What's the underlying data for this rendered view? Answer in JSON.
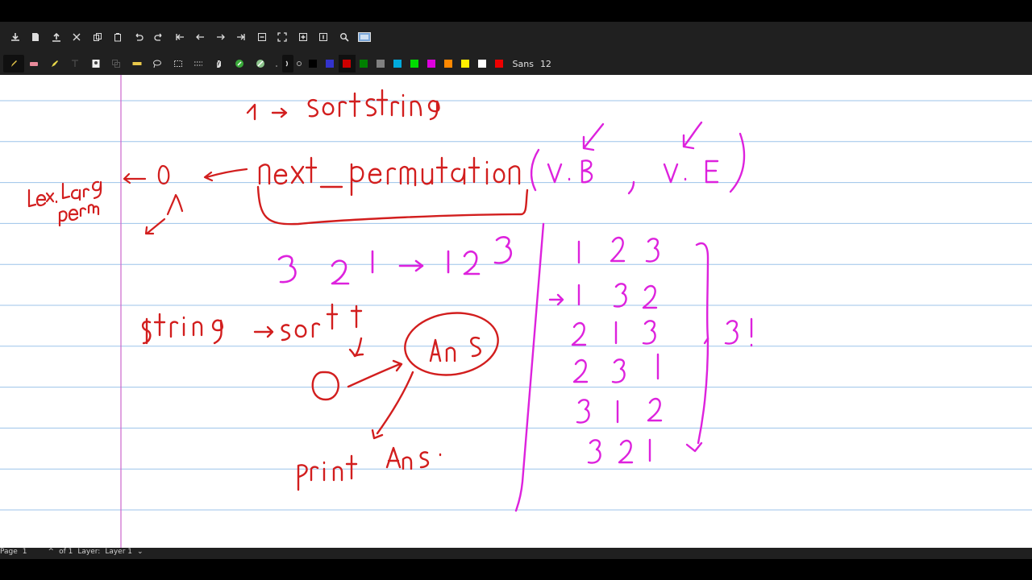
{
  "toolbar_top": {
    "buttons": [
      {
        "name": "save-icon"
      },
      {
        "name": "new-page-icon"
      },
      {
        "name": "upload-icon"
      },
      {
        "name": "cut-icon"
      },
      {
        "name": "copy-icon"
      },
      {
        "name": "paste-icon"
      },
      {
        "name": "undo-icon"
      },
      {
        "name": "redo-icon"
      },
      {
        "name": "first-page-icon"
      },
      {
        "name": "previous-page-icon"
      },
      {
        "name": "next-page-icon"
      },
      {
        "name": "last-page-icon"
      },
      {
        "name": "zoom-out-icon"
      },
      {
        "name": "fit-page-icon"
      },
      {
        "name": "zoom-in-icon"
      },
      {
        "name": "fullscreen-icon"
      },
      {
        "name": "search-icon"
      },
      {
        "name": "image-icon"
      }
    ]
  },
  "toolbar_tools": {
    "font_name": "Sans",
    "font_size": "12",
    "colors": [
      "#000000",
      "#3333cc",
      "#cc0000",
      "#008000",
      "#808080",
      "#00aadd",
      "#00dd00",
      "#dd00dd",
      "#ff8800",
      "#ffee00",
      "#ffffff",
      "#ee0000"
    ],
    "selected_color_index": 2
  },
  "status": {
    "page_label": "Page",
    "page_number": "1",
    "of_pages": "of 1",
    "layer_label": "Layer:",
    "layer_value": "Layer 1"
  },
  "notes": {
    "red_text": [
      "1 → sort string",
      "next_permutation",
      "Lex. Larg perm",
      "0",
      "String → sort",
      "Ans",
      "Print Ans."
    ],
    "magenta_text": [
      "(V.B , V.E)",
      "3 2 1 → 1 2 3",
      "1 2 3",
      "1 3 2",
      "2 1 3",
      "2 3 1",
      "3 1 2",
      "3 2 1",
      "3!"
    ]
  }
}
